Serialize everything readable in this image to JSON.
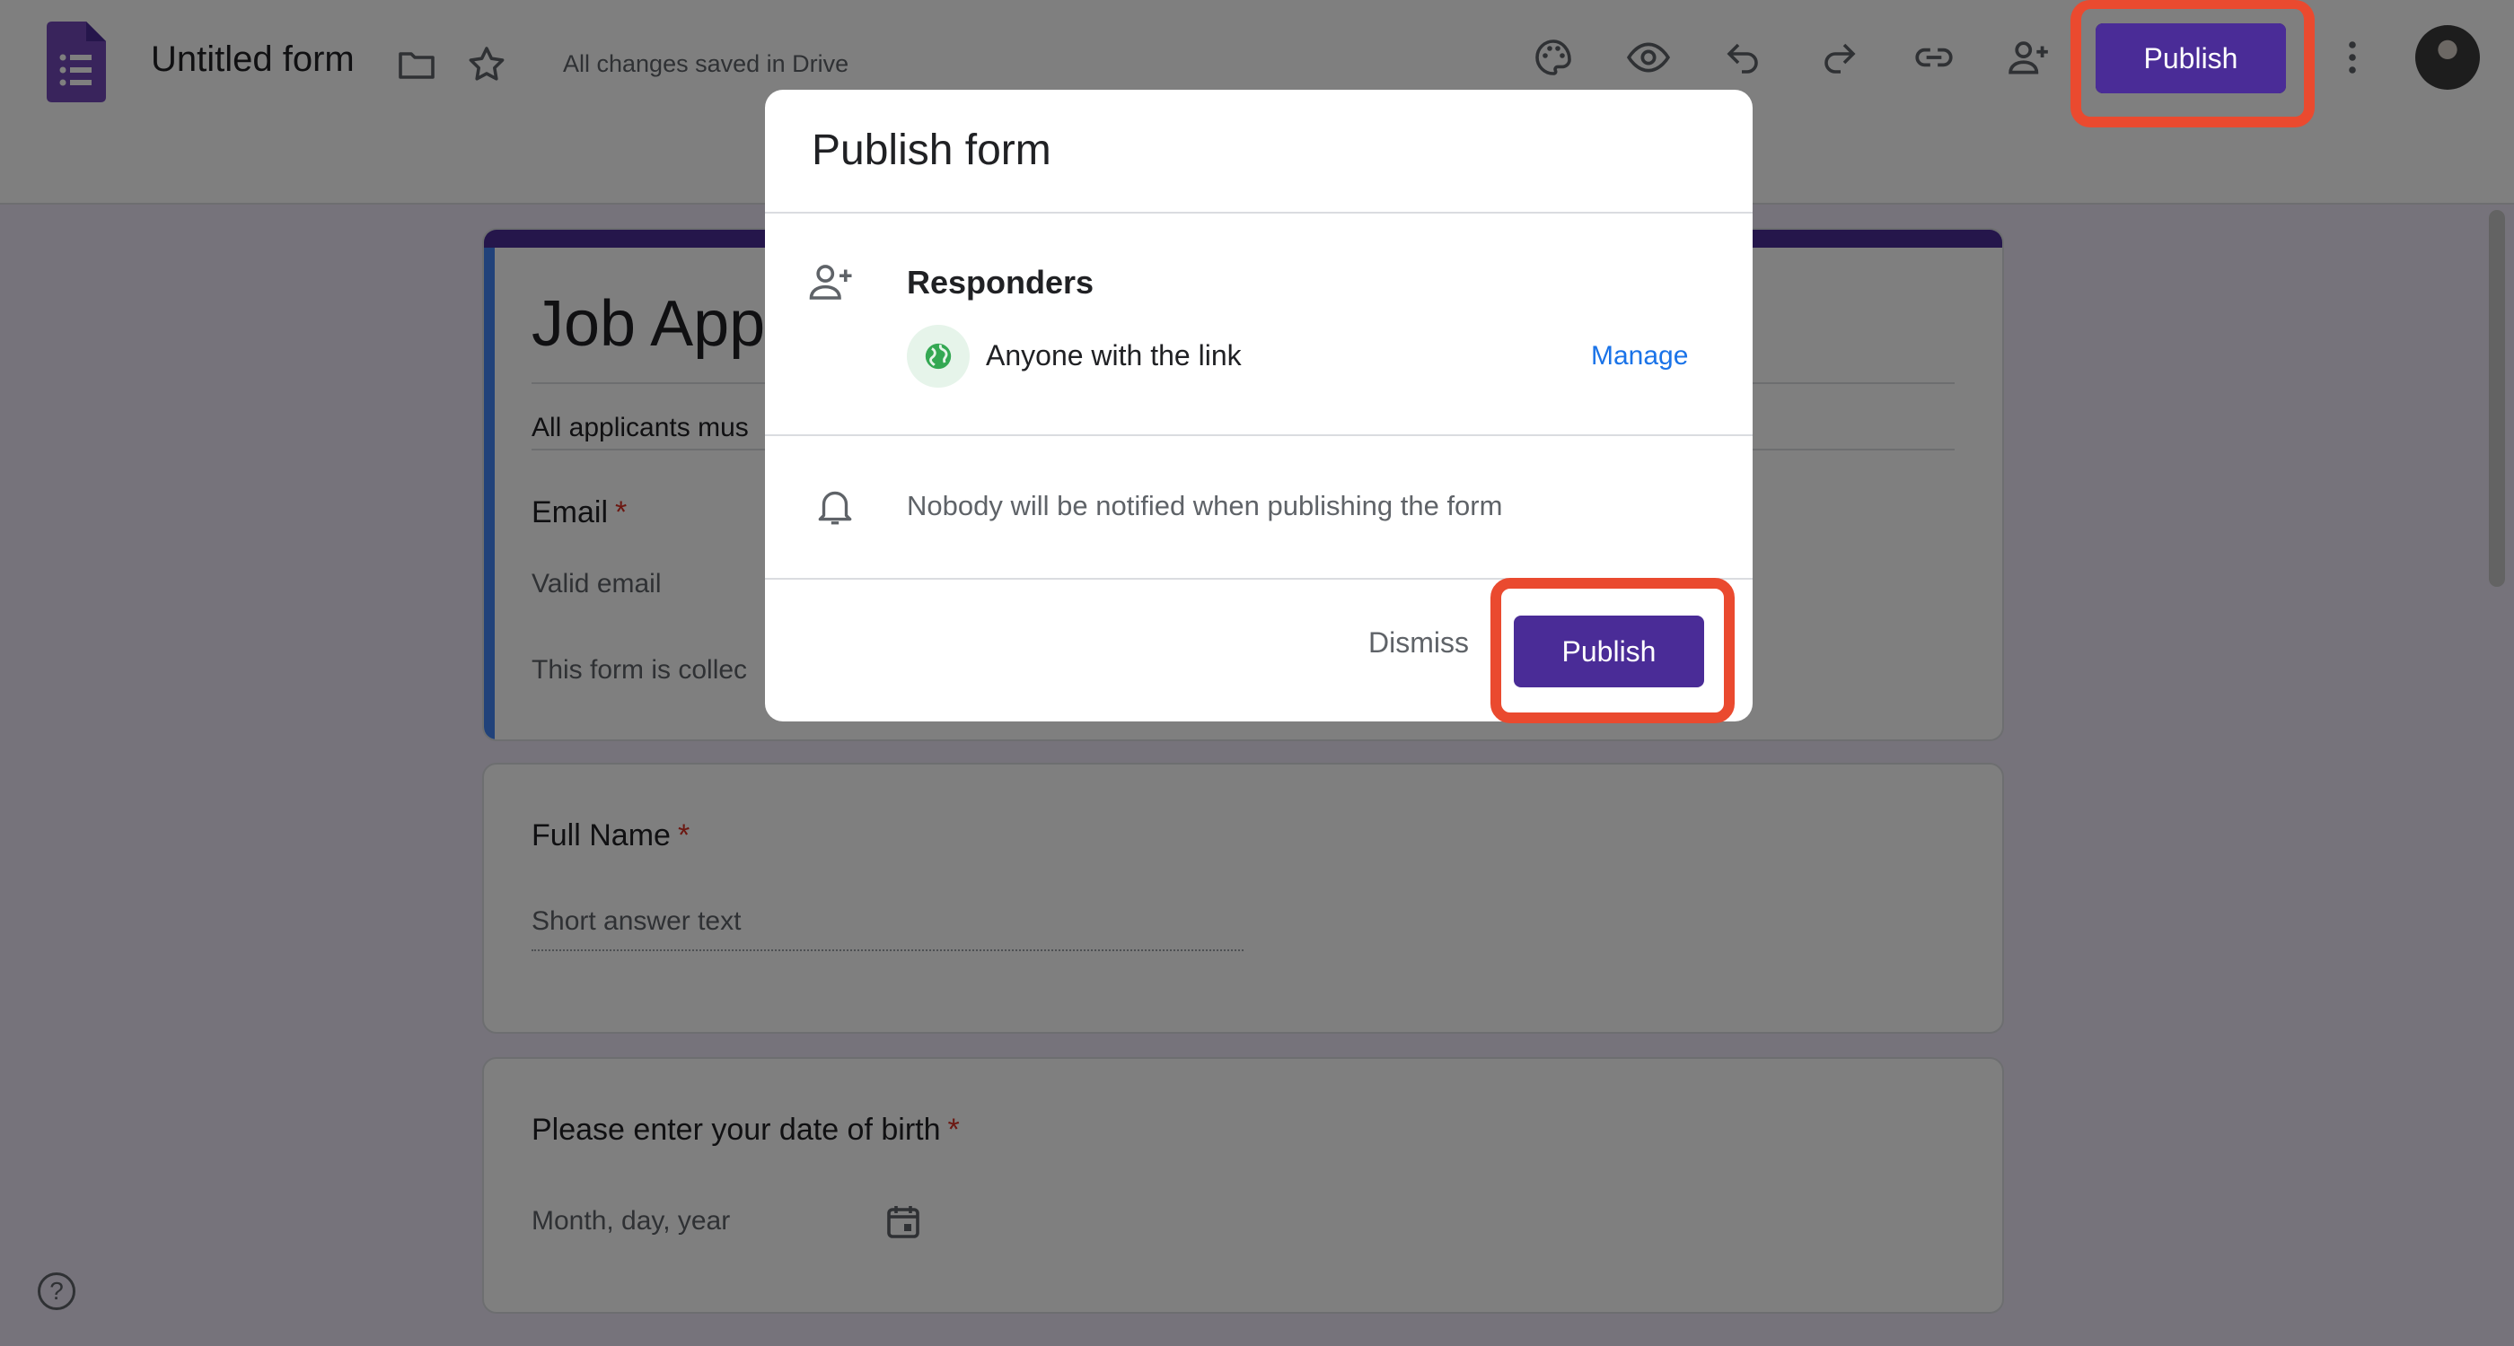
{
  "header": {
    "doc_title": "Untitled form",
    "saved_status": "All changes saved in Drive",
    "publish_label": "Publish",
    "icons": [
      "forms-logo-icon",
      "folder-icon",
      "star-icon",
      "palette-icon",
      "eye-icon",
      "undo-icon",
      "redo-icon",
      "link-icon",
      "add-person-icon",
      "more-vert-icon"
    ]
  },
  "form": {
    "title": "Job App",
    "description": "All applicants mus",
    "email_label": "Email",
    "email_placeholder": "Valid email",
    "collecting_note": "This form is collec",
    "questions": [
      {
        "label": "Full Name",
        "required_mark": "*",
        "hint": "Short answer text"
      },
      {
        "label": "Please enter your date of birth",
        "required_mark": "*",
        "hint": "Month, day, year"
      }
    ],
    "required_mark": "*"
  },
  "dialog": {
    "title": "Publish form",
    "responders_title": "Responders",
    "responders_value": "Anyone with the link",
    "manage_label": "Manage",
    "notify_text": "Nobody will be notified when publishing the form",
    "dismiss_label": "Dismiss",
    "publish_label": "Publish"
  },
  "help": {
    "symbol": "?"
  },
  "colors": {
    "brand": "#4a2c97",
    "highlight": "#ea4a2f",
    "link": "#1a73e8",
    "required": "#d93025"
  }
}
